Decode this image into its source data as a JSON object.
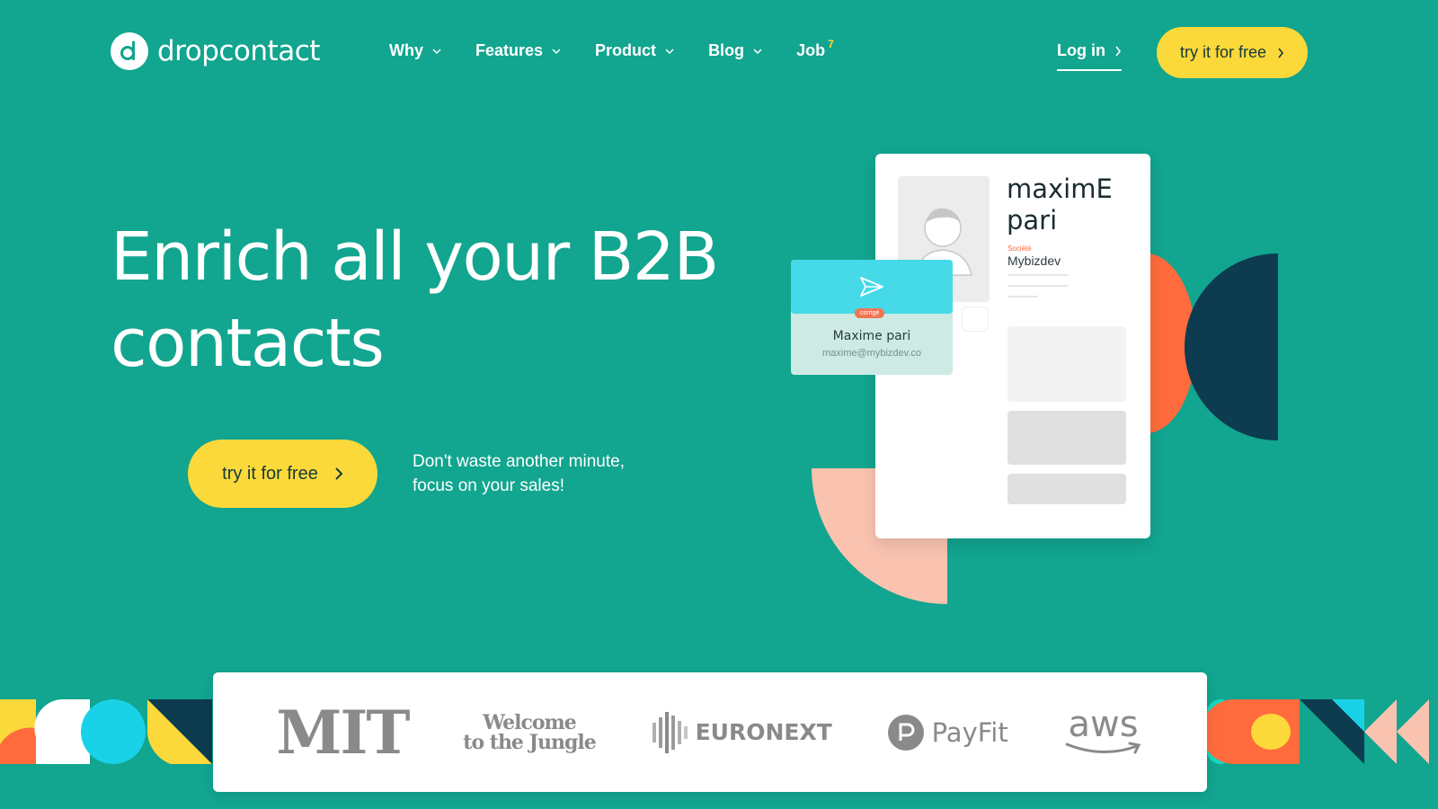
{
  "brand": {
    "name": "dropcontact"
  },
  "nav": {
    "items": [
      {
        "label": "Why",
        "has_dropdown": true
      },
      {
        "label": "Features",
        "has_dropdown": true
      },
      {
        "label": "Product",
        "has_dropdown": true
      },
      {
        "label": "Blog",
        "has_dropdown": true
      },
      {
        "label": "Job",
        "has_dropdown": false,
        "badge": "7"
      }
    ],
    "login": "Log in",
    "cta": "try it for free"
  },
  "hero": {
    "title_line1": "Enrich all your B2B",
    "title_line2": "contacts",
    "cta": "try it for free",
    "subtitle_line1": "Don't waste another minute,",
    "subtitle_line2": "focus on your sales!"
  },
  "illustration": {
    "card_name_line1": "maximE",
    "card_name_line2": "pari",
    "card_label": "Société",
    "card_company": "Mybizdev",
    "popup_badge": "corrigé",
    "popup_name": "Maxime pari",
    "popup_email": "maxime@mybizdev.co"
  },
  "partners": {
    "mit": "MIT",
    "wttj_line1": "Welcome",
    "wttj_line2": "to the Jungle",
    "euronext": "EURONEXT",
    "payfit": "PayFit",
    "aws": "aws"
  },
  "colors": {
    "background": "#12a58f",
    "accent_yellow": "#fbd93a",
    "accent_orange": "#ff6b3d",
    "accent_navy": "#0d3b4f",
    "accent_cyan": "#1ad2e8",
    "accent_peach": "#f9c3b0"
  }
}
